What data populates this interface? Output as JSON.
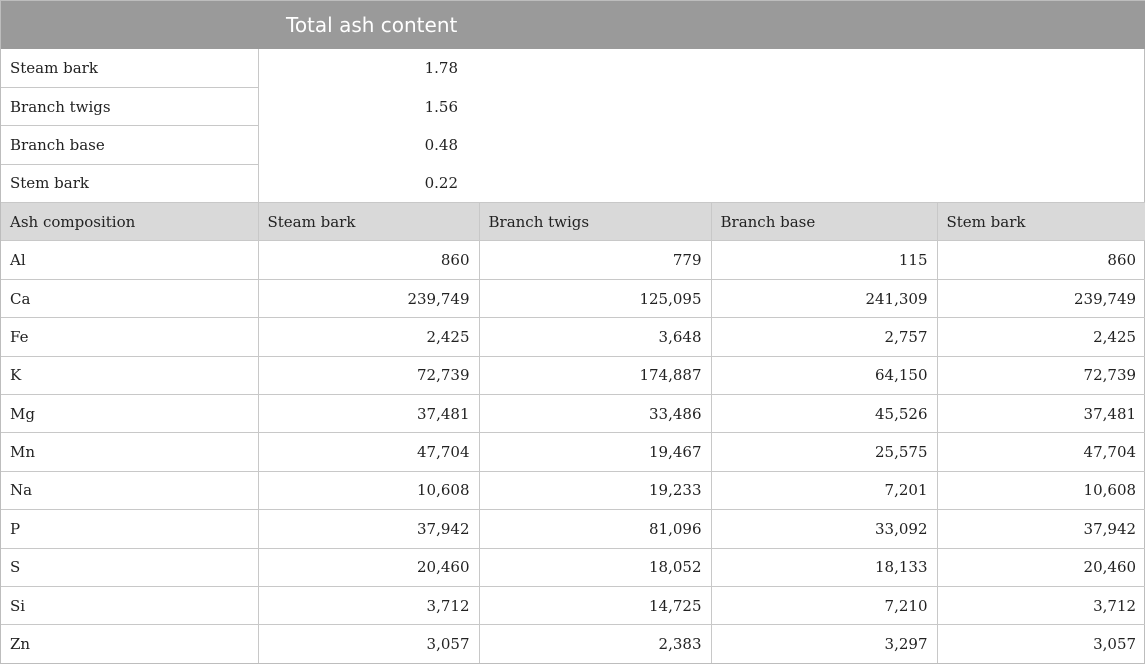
{
  "title": "Total ash content",
  "total_ash": [
    {
      "label": "Steam bark",
      "value": "1.78"
    },
    {
      "label": "Branch twigs",
      "value": "1.56"
    },
    {
      "label": "Branch base",
      "value": "0.48"
    },
    {
      "label": "Stem bark",
      "value": "0.22"
    }
  ],
  "composition": {
    "headers": [
      "Ash composition",
      "Steam bark",
      "Branch twigs",
      "Branch base",
      "Stem bark"
    ],
    "rows": [
      [
        "Al",
        "860",
        "779",
        "115",
        "860"
      ],
      [
        "Ca",
        "239,749",
        "125,095",
        "241,309",
        "239,749"
      ],
      [
        "Fe",
        "2,425",
        "3,648",
        "2,757",
        "2,425"
      ],
      [
        "K",
        "72,739",
        "174,887",
        "64,150",
        "72,739"
      ],
      [
        "Mg",
        "37,481",
        "33,486",
        "45,526",
        "37,481"
      ],
      [
        "Mn",
        "47,704",
        "19,467",
        "25,575",
        "47,704"
      ],
      [
        "Na",
        "10,608",
        "19,233",
        "7,201",
        "10,608"
      ],
      [
        "P",
        "37,942",
        "81,096",
        "33,092",
        "37,942"
      ],
      [
        "S",
        "20,460",
        "18,052",
        "18,133",
        "20,460"
      ],
      [
        "Si",
        "3,712",
        "14,725",
        "7,210",
        "3,712"
      ],
      [
        "Zn",
        "3,057",
        "2,383",
        "3,297",
        "3,057"
      ]
    ]
  }
}
